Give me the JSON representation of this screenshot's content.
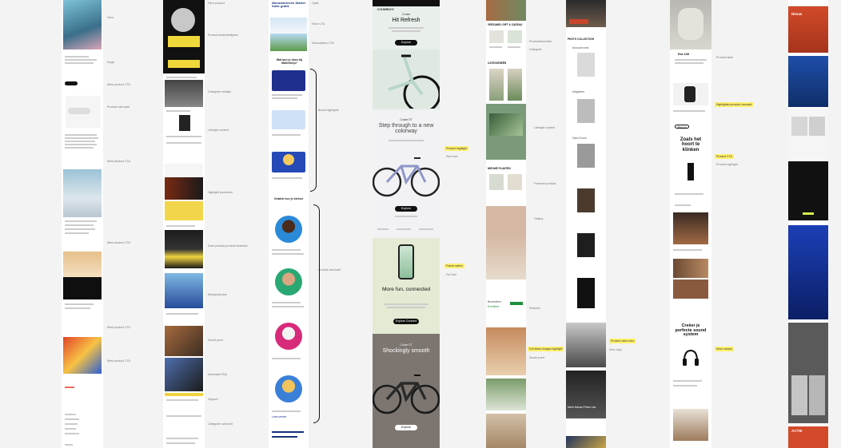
{
  "annotations": {
    "col1": [
      "Hero",
      "Kopje",
      "Merk product CTA",
      "Product carrousel",
      "Merk product CTA",
      "Merk product CTA",
      "Merk product CTA",
      "Merk product CTA",
      "Merk product CTA",
      "Merk product CTA"
    ],
    "col2": [
      "Hero product",
      "Product bestsellerlijsten",
      "Categorie merkjes",
      "Lifestyle content",
      "Highlight producten",
      "Deze product product bestellen",
      "Merkproducten",
      "Social proof",
      "Informatie FAQ",
      "Support",
      "Categorie overzicht"
    ],
    "col3": [
      "Optie",
      "Extra CTA",
      "Subscription CTA",
      "Brand highlights",
      "Product carrousel"
    ],
    "col5": [
      "Productinformatie",
      "Categorie",
      "Lifestyle content",
      "Featured product",
      "Reviews",
      "Gallery",
      "Social proof"
    ],
    "col6": [
      "Intro copy"
    ],
    "col7": [
      "Product label",
      "Product highlight"
    ]
  },
  "stickies": {
    "s1": "Product highlight",
    "s2": "Frame switch",
    "s3": "Full bleed images highlight",
    "s4": "Product video hero",
    "s5": "Highlighted product carousel",
    "s6": "Product CTA",
    "s7": "Kleur variant"
  },
  "col3_content": {
    "top_title": "Nieuwsbrieven Starter Suite gratis",
    "section_title": "Wat kun je doen bij Mailchimp?",
    "quote": "Ontdek hoe je kleiner",
    "cta": "Lees verder"
  },
  "col4_content": {
    "brand": "COWBOY",
    "s1_label": "Cruise",
    "s1_title": "Hit Refresh",
    "s1_button": "Explore",
    "s2_label": "Cruise ST",
    "s2_title": "Step through to a new colorway",
    "s2_button": "Explore",
    "s3_title": "More fun, connected",
    "s3_button": "Explore Connect",
    "s4_label": "Cruise ST",
    "s4_title": "Shockingly smooth",
    "s4_button": "Explore"
  },
  "col5_content": {
    "heading1": "VERZAMEL GIFT & CADEAU",
    "heading2": "CATEGORIEËN",
    "heading3": "NIEUWE PLANTEN",
    "label1": "Bestsellers",
    "review": "Excellent"
  },
  "col6_content": {
    "header": "Mama's Photo Lab",
    "header2": "PHOTO COLLECTION",
    "label1": "Monochrome",
    "label2": "Magazine",
    "label3": "Dark Room",
    "caption": "Meet Mama Photo Lab"
  },
  "col7_content": {
    "heading1": "Zoals het hoort te klinken",
    "heading2": "Creëer je perfecte sound system",
    "product": "Era 100",
    "cta": "Shop nu"
  },
  "col8_content": {
    "header": "Nieuw",
    "title": "Seizoen",
    "promo": "ACTIE"
  }
}
